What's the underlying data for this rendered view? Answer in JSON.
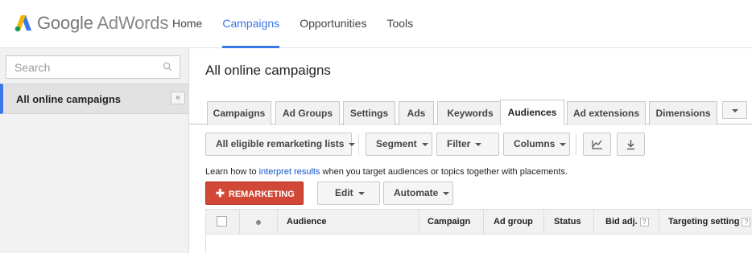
{
  "brand": {
    "google": "Google",
    "product": "AdWords"
  },
  "nav": [
    {
      "label": "Home"
    },
    {
      "label": "Campaigns"
    },
    {
      "label": "Opportunities"
    },
    {
      "label": "Tools"
    }
  ],
  "sidebar": {
    "search_placeholder": "Search",
    "selected_item": "All online campaigns",
    "collapse_label": "«"
  },
  "main": {
    "title": "All online campaigns",
    "tabs": [
      {
        "label": "Campaigns"
      },
      {
        "label": "Ad Groups"
      },
      {
        "label": "Settings"
      },
      {
        "label": "Ads"
      },
      {
        "label": "Keywords"
      },
      {
        "label": "Audiences"
      },
      {
        "label": "Ad extensions"
      },
      {
        "label": "Dimensions"
      }
    ],
    "toolbar": {
      "lists": "All eligible remarketing lists",
      "segment": "Segment",
      "filter": "Filter",
      "columns": "Columns"
    },
    "info": {
      "before": "Learn how to ",
      "link": "interpret results",
      "after": " when you target audiences or topics together with placements."
    },
    "actions": {
      "remarketing": "REMARKETING",
      "edit": "Edit",
      "automate": "Automate"
    },
    "table": {
      "headers": {
        "audience": "Audience",
        "campaign": "Campaign",
        "ad_group": "Ad group",
        "status": "Status",
        "bid_adj": "Bid adj.",
        "targeting": "Targeting setting"
      },
      "help_mark": "?"
    }
  }
}
